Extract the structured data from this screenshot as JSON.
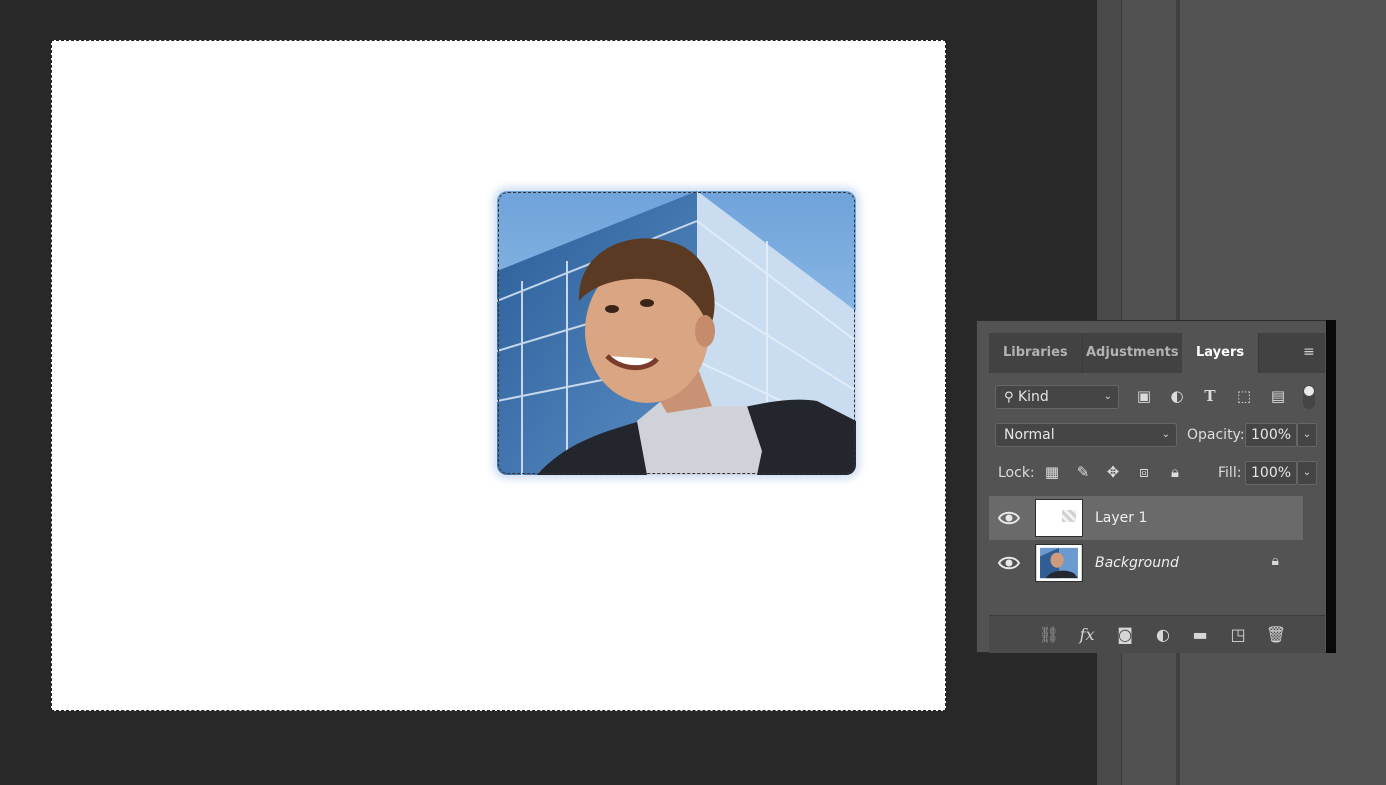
{
  "panel": {
    "tabs": [
      {
        "label": "Libraries",
        "active": false
      },
      {
        "label": "Adjustments",
        "active": false
      },
      {
        "label": "Layers",
        "active": true
      }
    ],
    "menu_icon": "hamburger-menu-icon"
  },
  "filter": {
    "kind_label": "Kind",
    "icons": [
      "image-filter-icon",
      "adjustment-filter-icon",
      "type-filter-icon",
      "shape-filter-icon",
      "smart-object-filter-icon"
    ]
  },
  "blend": {
    "mode": "Normal",
    "opacity_label": "Opacity:",
    "opacity_value": "100%"
  },
  "lock": {
    "label": "Lock:",
    "icons": [
      "lock-transparent-pixels-icon",
      "lock-image-pixels-icon",
      "lock-position-icon",
      "lock-artboard-icon",
      "lock-all-icon"
    ],
    "fill_label": "Fill:",
    "fill_value": "100%"
  },
  "layers": [
    {
      "name": "Layer 1",
      "visible": true,
      "selected": true,
      "locked": false,
      "italic": false
    },
    {
      "name": "Background",
      "visible": true,
      "selected": false,
      "locked": true,
      "italic": true
    }
  ],
  "footer_icons": [
    "link-layers-icon",
    "layer-style-fx-icon",
    "add-mask-icon",
    "new-adjustment-layer-icon",
    "new-group-folder-icon",
    "new-layer-icon",
    "delete-layer-trash-icon"
  ],
  "colors": {
    "workspace": "#282828",
    "panel": "#535353",
    "selected_layer": "#6a6a6a",
    "sky": "#7aaee0"
  }
}
